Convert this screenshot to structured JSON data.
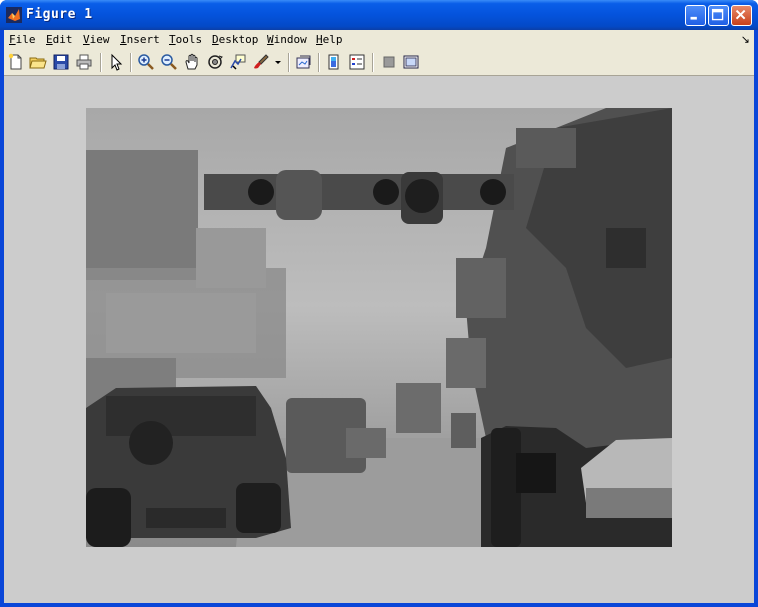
{
  "window": {
    "title": "Figure 1",
    "titlebar_color": "#0453dc",
    "buttons": [
      "minimize-icon",
      "maximize-icon",
      "close-icon"
    ]
  },
  "menubar": {
    "items": [
      {
        "label": "File",
        "mnemonic": "F",
        "rest": "ile"
      },
      {
        "label": "Edit",
        "mnemonic": "E",
        "rest": "dit"
      },
      {
        "label": "View",
        "mnemonic": "V",
        "rest": "iew"
      },
      {
        "label": "Insert",
        "mnemonic": "I",
        "rest": "nsert"
      },
      {
        "label": "Tools",
        "mnemonic": "T",
        "rest": "ools"
      },
      {
        "label": "Desktop",
        "mnemonic": "D",
        "rest": "esktop"
      },
      {
        "label": "Window",
        "mnemonic": "W",
        "rest": "indow"
      },
      {
        "label": "Help",
        "mnemonic": "H",
        "rest": "elp"
      }
    ],
    "dock_glyph": "↘"
  },
  "toolbar": {
    "icons": [
      "new-figure-icon",
      "open-file-icon",
      "save-icon",
      "print-icon",
      "edit-plot-icon",
      "zoom-in-icon",
      "zoom-out-icon",
      "pan-icon",
      "rotate-3d-icon",
      "data-cursor-icon",
      "brush-icon",
      "brush-dropdown-icon",
      "link-plot-icon",
      "colorbar-icon",
      "legend-icon",
      "hide-plot-tools-icon",
      "show-plot-tools-icon"
    ]
  },
  "figure": {
    "background": "#cccccc",
    "image_description_colors": {
      "sky": "#b8b8b8",
      "dark": "#2a2a2a"
    }
  }
}
